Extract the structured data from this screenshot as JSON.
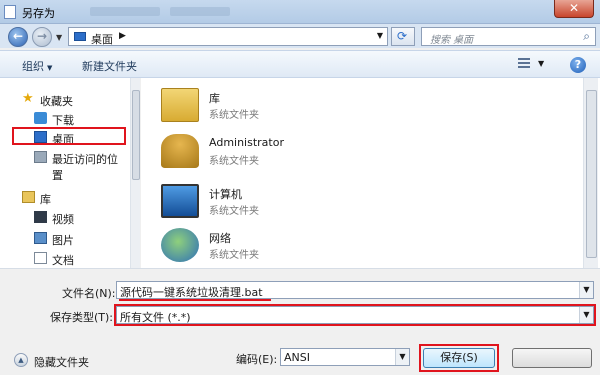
{
  "window": {
    "title": "另存为"
  },
  "address": {
    "crumb": "桌面",
    "search_placeholder": "搜索 桌面"
  },
  "toolbar": {
    "organize": "组织",
    "new_folder": "新建文件夹"
  },
  "sidebar": {
    "favorites": "收藏夹",
    "downloads": "下载",
    "desktop": "桌面",
    "recent": "最近访问的位置",
    "libraries": "库",
    "videos": "视频",
    "pictures": "图片",
    "documents": "文档"
  },
  "files": [
    {
      "name": "库",
      "kind": "系统文件夹"
    },
    {
      "name": "Administrator",
      "kind": "系统文件夹"
    },
    {
      "name": "计算机",
      "kind": "系统文件夹"
    },
    {
      "name": "网络",
      "kind": "系统文件夹"
    }
  ],
  "form": {
    "filename_label": "文件名(N):",
    "filename_value": "源代码一键系统垃圾清理.bat",
    "filetype_label": "保存类型(T):",
    "filetype_value": "所有文件 (*.*)",
    "encoding_label": "编码(E):",
    "encoding_value": "ANSI",
    "hide_folders": "隐藏文件夹",
    "save": "保存(S)"
  },
  "colors": {
    "highlight": "#e0141d",
    "accent": "#2c6ec9"
  }
}
